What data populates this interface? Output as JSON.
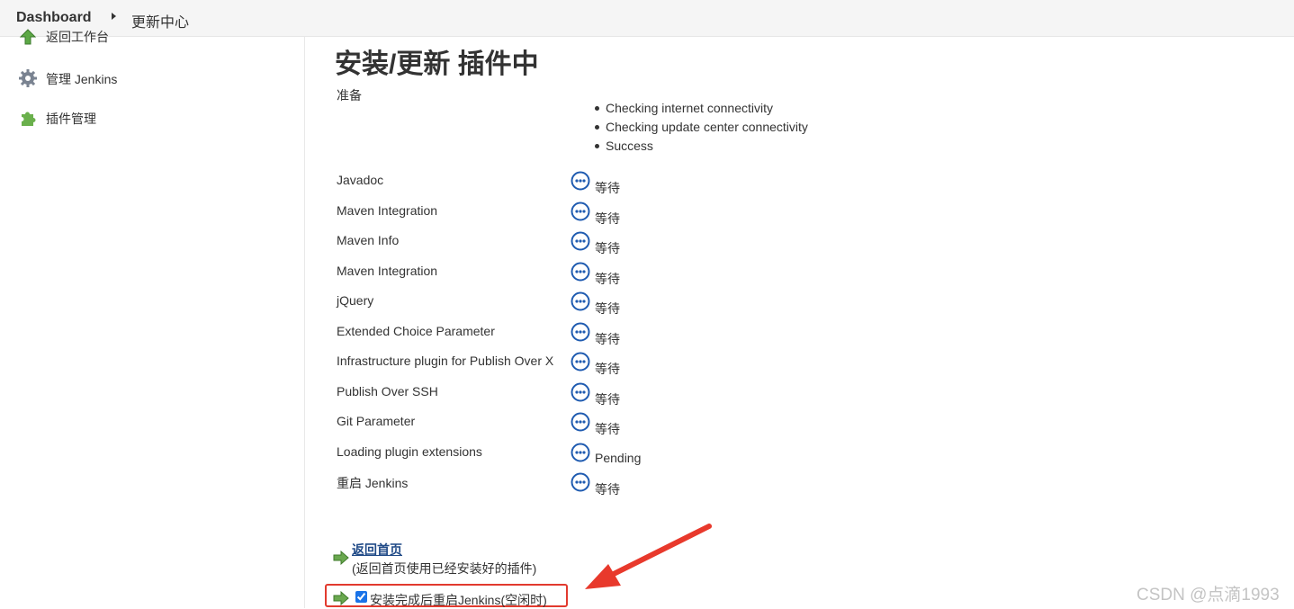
{
  "breadcrumb": {
    "home": "Dashboard",
    "current": "更新中心"
  },
  "sidebar": {
    "items": [
      {
        "label": "返回工作台",
        "icon": "up-arrow-icon"
      },
      {
        "label": "管理 Jenkins",
        "icon": "gear-icon"
      },
      {
        "label": "插件管理",
        "icon": "puzzle-icon"
      }
    ]
  },
  "main": {
    "title": "安装/更新 插件中",
    "prepare_label": "准备",
    "checks": [
      "Checking internet connectivity",
      "Checking update center connectivity",
      "Success"
    ],
    "plugins": [
      {
        "name": "Javadoc",
        "status": "等待"
      },
      {
        "name": "Maven Integration",
        "status": "等待"
      },
      {
        "name": "Maven Info",
        "status": "等待"
      },
      {
        "name": "Maven Integration",
        "status": "等待"
      },
      {
        "name": "jQuery",
        "status": "等待"
      },
      {
        "name": "Extended Choice Parameter",
        "status": "等待"
      },
      {
        "name": "Infrastructure plugin for Publish Over X",
        "status": "等待"
      },
      {
        "name": "Publish Over SSH",
        "status": "等待"
      },
      {
        "name": "Git Parameter",
        "status": "等待"
      },
      {
        "name": "Loading plugin extensions",
        "status": "Pending"
      },
      {
        "name": "重启 Jenkins",
        "status": "等待"
      }
    ],
    "back_link": "返回首页",
    "back_note": "(返回首页使用已经安装好的插件)",
    "restart_label": "安装完成后重启Jenkins(空闲时)",
    "restart_checked": true
  },
  "watermark": "CSDN @点滴1993",
  "colors": {
    "link": "#204a87",
    "status_icon": "#1f5bb0",
    "highlight": "#e23a2e",
    "arrow_green": "#6aa84f"
  }
}
